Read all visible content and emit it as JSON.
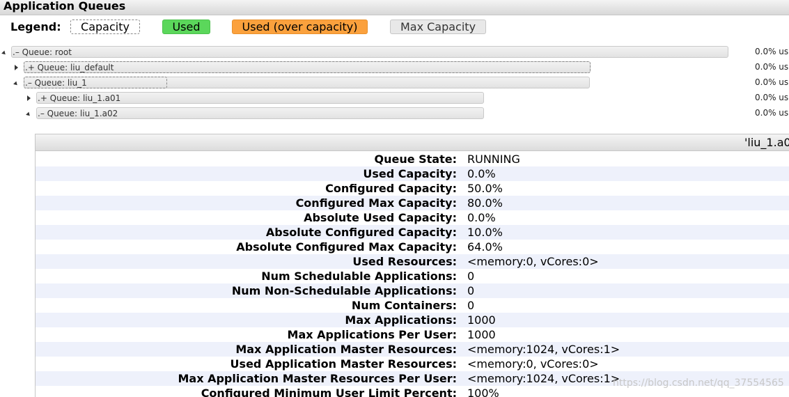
{
  "section": {
    "title": "Application Queues"
  },
  "legend": {
    "label": "Legend:",
    "capacity": "Capacity",
    "used": "Used",
    "used_over": "Used (over capacity)",
    "max_capacity": "Max Capacity"
  },
  "queues": [
    {
      "label": ".– Queue: root",
      "pct": "0.0% us",
      "expanded": true
    },
    {
      "label": ".+ Queue: liu_default",
      "pct": "0.0% us",
      "expanded": false
    },
    {
      "label": ".– Queue: liu_1",
      "pct": "0.0% us",
      "expanded": true
    },
    {
      "label": ".+ Queue: liu_1.a01",
      "pct": "0.0% us",
      "expanded": false
    },
    {
      "label": ".– Queue: liu_1.a02",
      "pct": "0.0% us",
      "expanded": true
    }
  ],
  "detail": {
    "title": "'liu_1.a0",
    "rows": [
      {
        "key": "Queue State:",
        "value": "RUNNING"
      },
      {
        "key": "Used Capacity:",
        "value": "0.0%"
      },
      {
        "key": "Configured Capacity:",
        "value": "50.0%"
      },
      {
        "key": "Configured Max Capacity:",
        "value": "80.0%"
      },
      {
        "key": "Absolute Used Capacity:",
        "value": "0.0%"
      },
      {
        "key": "Absolute Configured Capacity:",
        "value": "10.0%"
      },
      {
        "key": "Absolute Configured Max Capacity:",
        "value": "64.0%"
      },
      {
        "key": "Used Resources:",
        "value": "<memory:0, vCores:0>"
      },
      {
        "key": "Num Schedulable Applications:",
        "value": "0"
      },
      {
        "key": "Num Non-Schedulable Applications:",
        "value": "0"
      },
      {
        "key": "Num Containers:",
        "value": "0"
      },
      {
        "key": "Max Applications:",
        "value": "1000"
      },
      {
        "key": "Max Applications Per User:",
        "value": "1000"
      },
      {
        "key": "Max Application Master Resources:",
        "value": "<memory:1024, vCores:1>"
      },
      {
        "key": "Used Application Master Resources:",
        "value": "<memory:0, vCores:0>"
      },
      {
        "key": "Max Application Master Resources Per User:",
        "value": "<memory:1024, vCores:1>"
      },
      {
        "key": "Configured Minimum User Limit Percent:",
        "value": "100%"
      }
    ]
  },
  "watermark": "https://blog.csdn.net/qq_37554565",
  "colors": {
    "used": "#5bd75b",
    "used_over": "#fba13d",
    "max_capacity": "#e8e8e8",
    "row_alt": "#eef1fb"
  },
  "icons": [
    "tree-expanded-icon",
    "tree-collapsed-icon"
  ]
}
